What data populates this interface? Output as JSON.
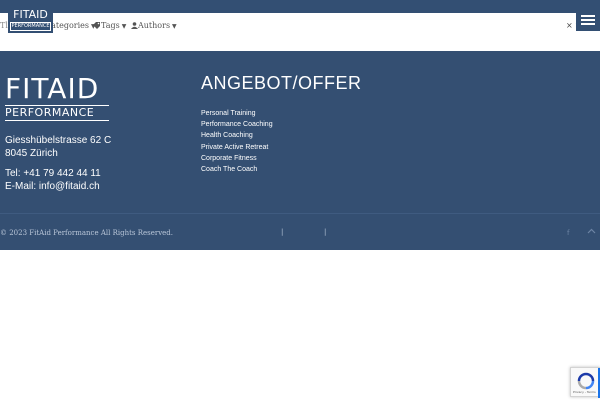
{
  "header": {
    "logo_line1": "FITAID",
    "logo_line2": "PERFORMANCE",
    "filter_link": "Tl",
    "categories_label": "Categories",
    "tags_label": "Tags",
    "authors_label": "Authors",
    "clear_label": "× S"
  },
  "footer": {
    "logo_line1": "FITAID",
    "logo_line2": "PERFORMANCE",
    "address_line1": "Giesshübelstrasse 62 C",
    "address_line2": "8045 Zürich",
    "phone": "Tel: +41 79 442 44 11",
    "email": "E-Mail: info@fitaid.ch",
    "offer_title": "ANGEBOT/OFFER",
    "offer_items": [
      "Personal Training",
      "Performance Coaching",
      "Health Coaching",
      "Private Active Retreat",
      "Corporate Fitness",
      "Coach The Coach"
    ],
    "copyright": "© 2023 FitAid Performance All Rights Reserved.",
    "separator": "|",
    "facebook_glyph": "f"
  },
  "recaptcha": {
    "privacy_text": "Privacy - Terms"
  },
  "colors": {
    "brand_blue": "#344f72",
    "white": "#ffffff"
  },
  "icons": [
    "menu-icon",
    "tag-icon",
    "user-icon",
    "facebook-icon",
    "arrow-up-icon",
    "recaptcha-icon"
  ]
}
